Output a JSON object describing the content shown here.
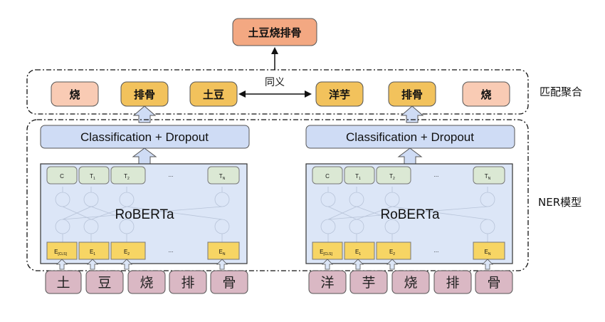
{
  "output": {
    "label": "土豆烧排骨",
    "color": "#f3a882"
  },
  "match": {
    "left_words": [
      "烧",
      "排骨",
      "土豆"
    ],
    "right_words": [
      "洋芋",
      "排骨",
      "烧"
    ],
    "synonym_label": "同义",
    "group_label": "匹配聚合"
  },
  "model": {
    "group_label": "NER模型",
    "classifier_label": "Classification + Dropout",
    "encoder_label": "RoBERTa",
    "top_tokens": [
      "C",
      "T",
      "T",
      "...",
      "T"
    ],
    "top_subs": [
      "",
      "1",
      "2",
      "",
      "N"
    ],
    "bottom_tokens": [
      "E",
      "E",
      "E",
      "...",
      "E"
    ],
    "bottom_subs": [
      "[CLS]",
      "1",
      "2",
      "",
      "N"
    ]
  },
  "inputs": {
    "left": [
      "土",
      "豆",
      "烧",
      "排",
      "骨"
    ],
    "right": [
      "洋",
      "芋",
      "烧",
      "排",
      "骨"
    ]
  },
  "colors": {
    "salmon": "#f9cbb4",
    "gold": "#f2c25c",
    "blue_box": "#cfdcf5",
    "encoder_bg": "#dce6f7",
    "token_green": "#dbe8d4",
    "token_yellow": "#f7d564",
    "input_pink": "#dab8c4"
  }
}
